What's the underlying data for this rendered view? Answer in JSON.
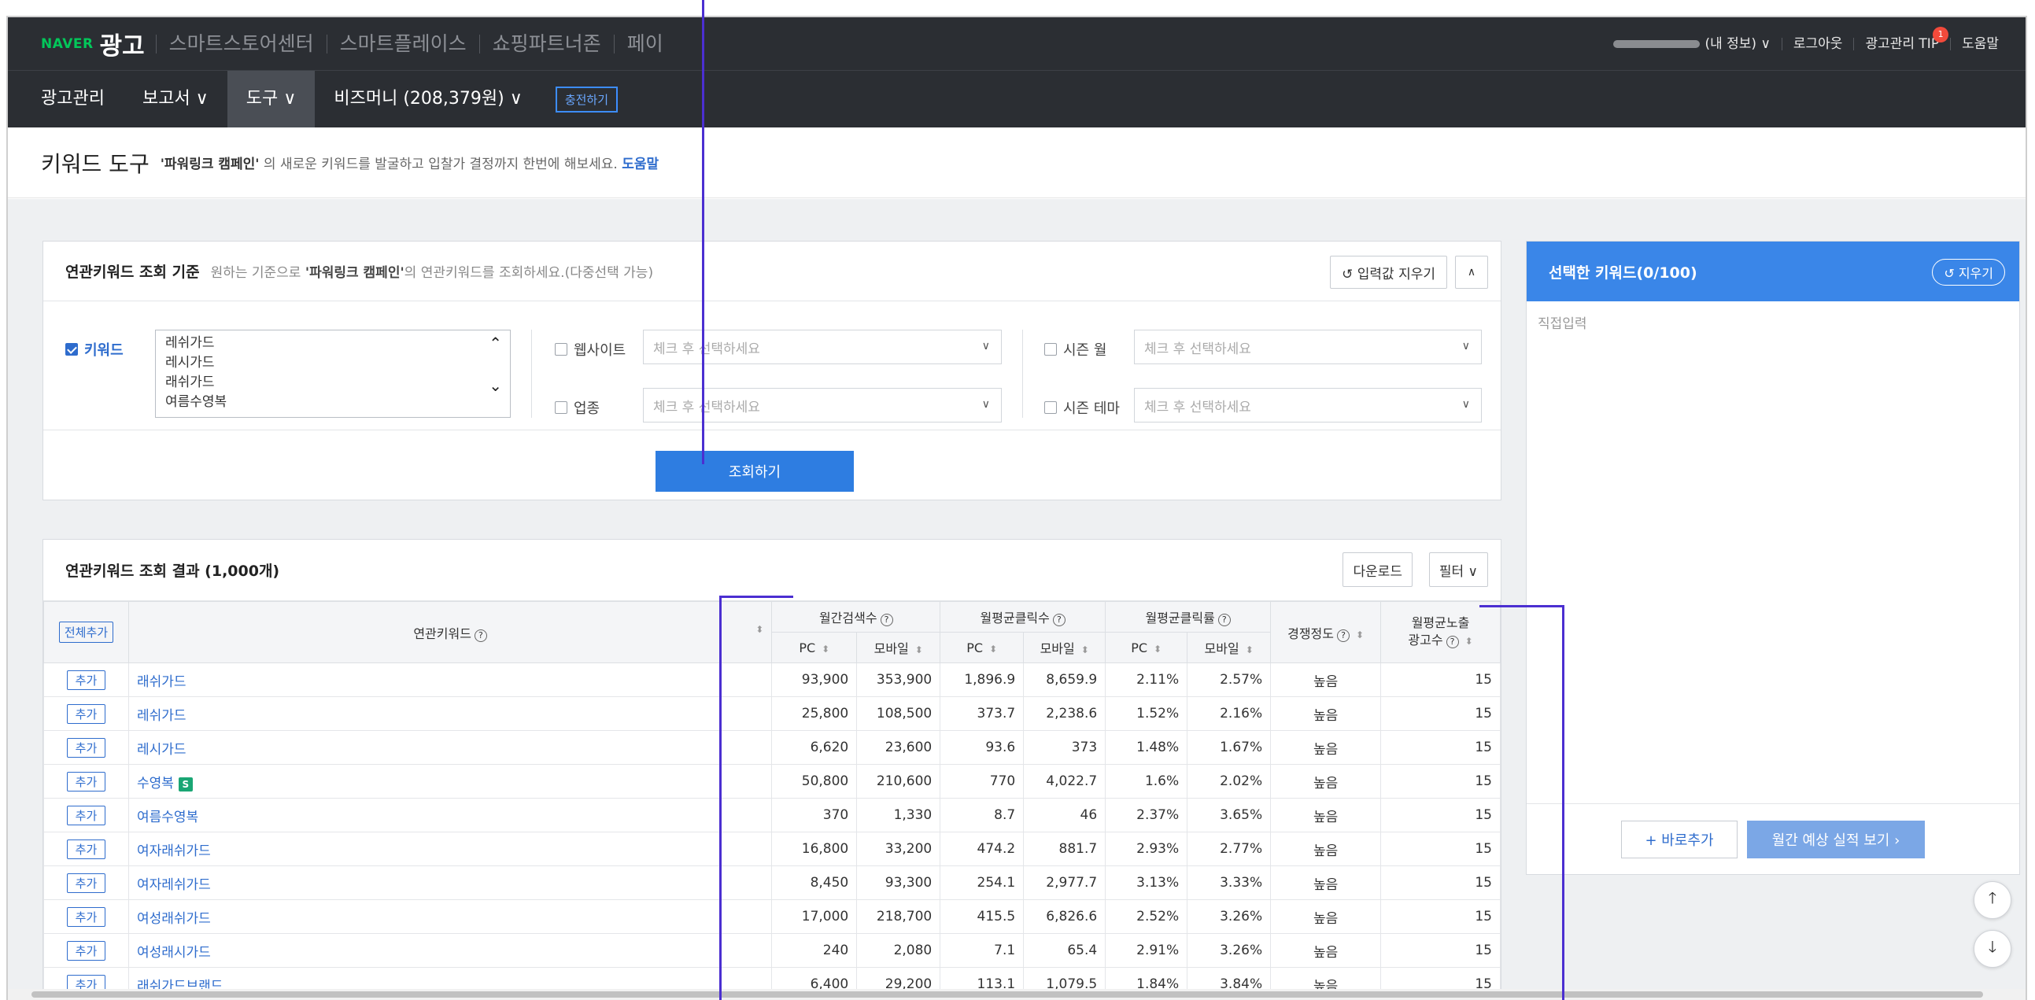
{
  "topbar": {
    "brand_naver": "NAVER",
    "brand_name": "광고",
    "services": [
      "스마트스토어센터",
      "스마트플레이스",
      "쇼핑파트너존",
      "페이"
    ],
    "my_info": "(내 정보) ∨",
    "logout": "로그아웃",
    "tip": "광고관리 TIP",
    "tip_badge": "1",
    "help": "도움말"
  },
  "nav": {
    "items": [
      "광고관리",
      "보고서 ∨",
      "도구 ∨",
      "비즈머니 (208,379원) ∨"
    ],
    "charge": "충전하기"
  },
  "page": {
    "title": "키워드 도구",
    "campaign": "'파워링크 캠페인'",
    "desc": "의 새로운 키워드를 발굴하고 입찰가 결정까지 한번에 해보세요.",
    "help": "도움말"
  },
  "criteria": {
    "title": "연관키워드 조회 기준",
    "desc_pre": "원하는 기준으로",
    "desc_campaign": "'파워링크 캠페인'",
    "desc_post": "의 연관키워드를 조회하세요.(다중선택 가능)",
    "clear_label": "↺ 입력값 지우기",
    "collapse_label": "∧",
    "keyword_label": "키워드",
    "keywords": [
      "레쉬가드",
      "레시가드",
      "래쉬가드",
      "여름수영복"
    ],
    "website_label": "웹사이트",
    "industry_label": "업종",
    "season_month_label": "시즌 월",
    "season_theme_label": "시즌 테마",
    "placeholder": "체크 후 선택하세요",
    "search_button": "조회하기"
  },
  "results": {
    "title": "연관키워드 조회 결과 (1,000개)",
    "download": "다운로드",
    "filter": "필터 ∨",
    "add_all": "전체추가",
    "col_keyword": "연관키워드",
    "col_monthly_search": "월간검색수",
    "col_monthly_clicks": "월평균클릭수",
    "col_monthly_ctr": "월평균클릭률",
    "col_competition": "경쟁정도",
    "col_ad_exposure_1": "월평균노출",
    "col_ad_exposure_2": "광고수",
    "pc": "PC",
    "mobile": "모바일",
    "add": "추가",
    "rows": [
      {
        "keyword": "래쉬가드",
        "badge": "",
        "pc_search": "93,900",
        "mo_search": "353,900",
        "pc_click": "1,896.9",
        "mo_click": "8,659.9",
        "pc_ctr": "2.11%",
        "mo_ctr": "2.57%",
        "comp": "높음",
        "ads": "15"
      },
      {
        "keyword": "레쉬가드",
        "badge": "",
        "pc_search": "25,800",
        "mo_search": "108,500",
        "pc_click": "373.7",
        "mo_click": "2,238.6",
        "pc_ctr": "1.52%",
        "mo_ctr": "2.16%",
        "comp": "높음",
        "ads": "15"
      },
      {
        "keyword": "레시가드",
        "badge": "",
        "pc_search": "6,620",
        "mo_search": "23,600",
        "pc_click": "93.6",
        "mo_click": "373",
        "pc_ctr": "1.48%",
        "mo_ctr": "1.67%",
        "comp": "높음",
        "ads": "15"
      },
      {
        "keyword": "수영복",
        "badge": "S",
        "pc_search": "50,800",
        "mo_search": "210,600",
        "pc_click": "770",
        "mo_click": "4,022.7",
        "pc_ctr": "1.6%",
        "mo_ctr": "2.02%",
        "comp": "높음",
        "ads": "15"
      },
      {
        "keyword": "여름수영복",
        "badge": "",
        "pc_search": "370",
        "mo_search": "1,330",
        "pc_click": "8.7",
        "mo_click": "46",
        "pc_ctr": "2.37%",
        "mo_ctr": "3.65%",
        "comp": "높음",
        "ads": "15"
      },
      {
        "keyword": "여자래쉬가드",
        "badge": "",
        "pc_search": "16,800",
        "mo_search": "33,200",
        "pc_click": "474.2",
        "mo_click": "881.7",
        "pc_ctr": "2.93%",
        "mo_ctr": "2.77%",
        "comp": "높음",
        "ads": "15"
      },
      {
        "keyword": "여자레쉬가드",
        "badge": "",
        "pc_search": "8,450",
        "mo_search": "93,300",
        "pc_click": "254.1",
        "mo_click": "2,977.7",
        "pc_ctr": "3.13%",
        "mo_ctr": "3.33%",
        "comp": "높음",
        "ads": "15"
      },
      {
        "keyword": "여성래쉬가드",
        "badge": "",
        "pc_search": "17,000",
        "mo_search": "218,700",
        "pc_click": "415.5",
        "mo_click": "6,826.6",
        "pc_ctr": "2.52%",
        "mo_ctr": "3.26%",
        "comp": "높음",
        "ads": "15"
      },
      {
        "keyword": "여성래시가드",
        "badge": "",
        "pc_search": "240",
        "mo_search": "2,080",
        "pc_click": "7.1",
        "mo_click": "65.4",
        "pc_ctr": "2.91%",
        "mo_ctr": "3.26%",
        "comp": "높음",
        "ads": "15"
      },
      {
        "keyword": "래쉬가드브랜드",
        "badge": "",
        "pc_search": "6,400",
        "mo_search": "29,200",
        "pc_click": "113.1",
        "mo_click": "1,079.5",
        "pc_ctr": "1.84%",
        "mo_ctr": "3.84%",
        "comp": "높음",
        "ads": "15"
      }
    ]
  },
  "selected": {
    "title": "선택한 키워드(0/100)",
    "clear": "↺ 지우기",
    "input_placeholder": "직접입력",
    "quick_add": "+ 바로추가",
    "forecast": "월간 예상 실적 보기 ›"
  },
  "colors": {
    "topbar": "#2b2e33",
    "accent": "#2e7de1",
    "link": "#2e6ccd",
    "annotation": "#4b2fd1",
    "naver_green": "#03c75a"
  }
}
